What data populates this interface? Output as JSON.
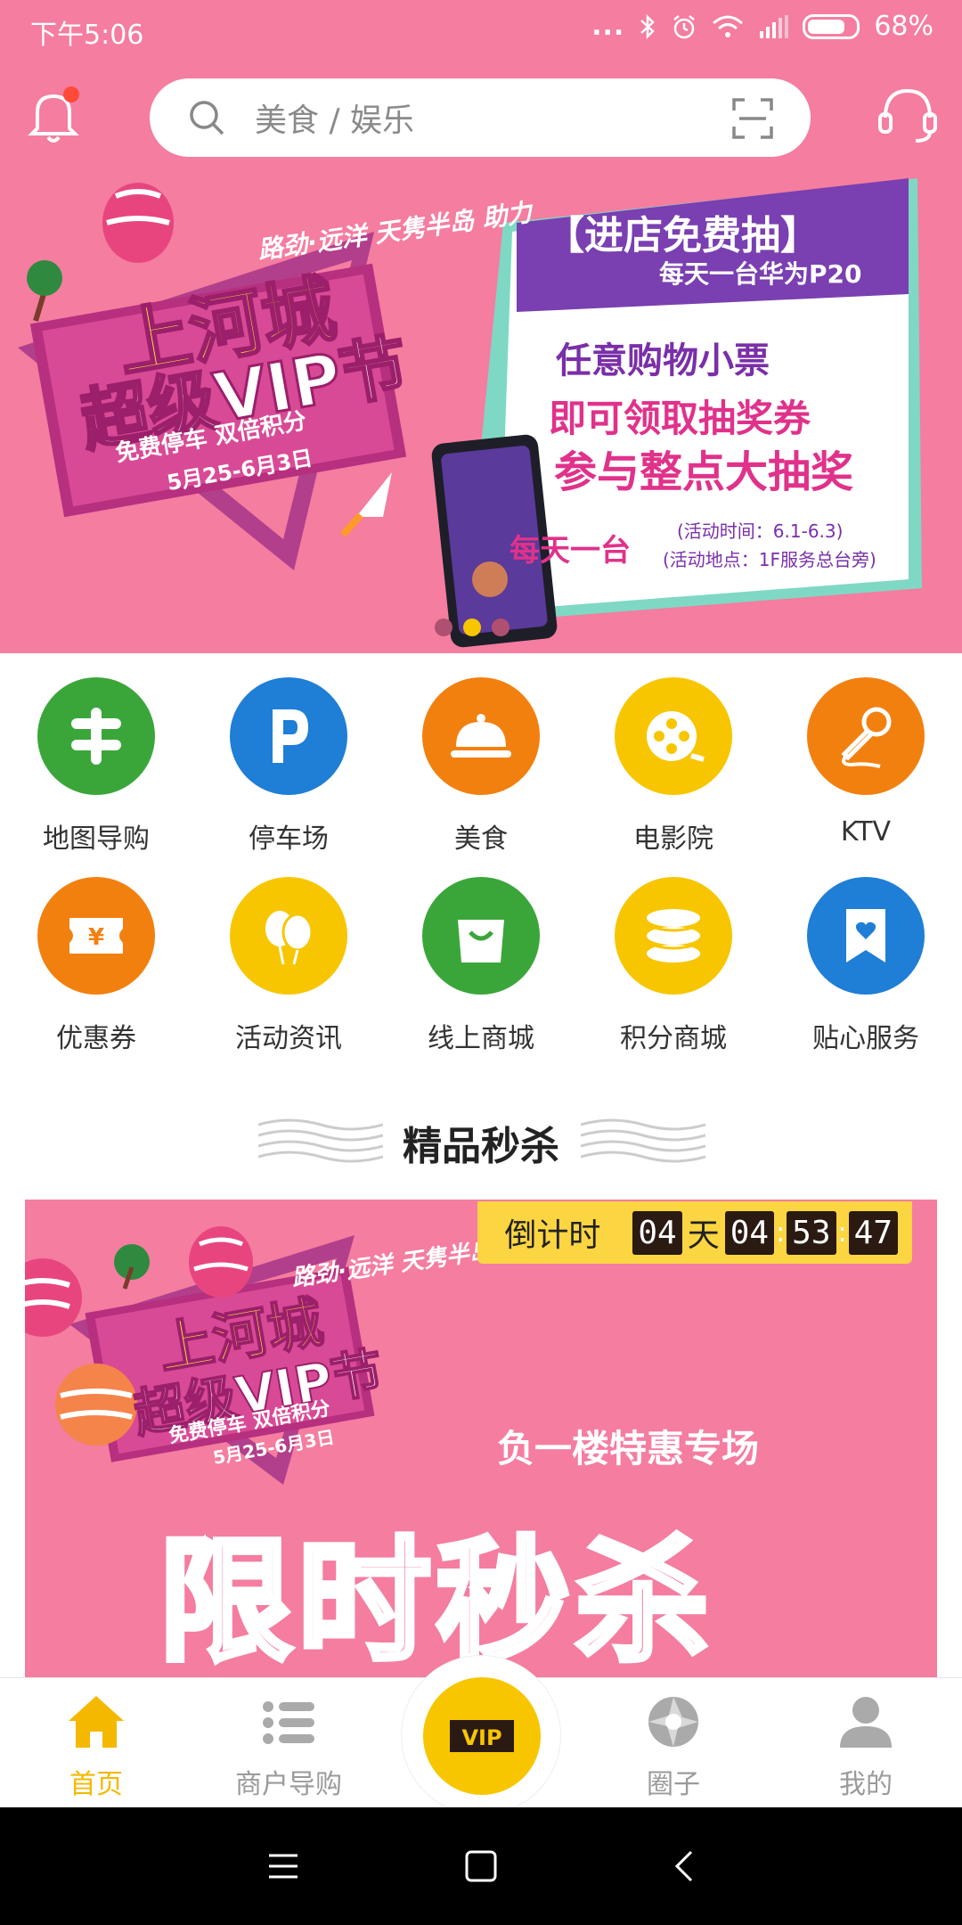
{
  "status": {
    "time": "下午5:06",
    "dots": "...",
    "battery": "68%"
  },
  "search": {
    "placeholder": "美食 / 娱乐"
  },
  "banner": {
    "sponsor": "路劲·远洋 天隽半岛 助力",
    "title_line1": "上河城",
    "title_line2": "超级VIP节",
    "tagline": "免费停车 双倍积分",
    "dates": "5月25-6月3日",
    "card_title": "【进店免费抽】",
    "card_subtitle": "每天一台华为P20",
    "line1": "任意购物小票",
    "line2": "即可领取抽奖券",
    "line3": "参与整点大抽奖",
    "daily": "每天一台",
    "activity_time": "(活动时间：6.1-6.3)",
    "activity_place": "(活动地点：1F服务总台旁)",
    "slide_count": 3,
    "active_slide": 2
  },
  "grid": {
    "row1": [
      {
        "label": "地图导购",
        "icon": "map-guide-icon",
        "color": "#3aa63a"
      },
      {
        "label": "停车场",
        "icon": "parking-icon",
        "color": "#1f7ed6"
      },
      {
        "label": "美食",
        "icon": "food-cloche-icon",
        "color": "#f2800f"
      },
      {
        "label": "电影院",
        "icon": "film-reel-icon",
        "color": "#f7c600"
      },
      {
        "label": "KTV",
        "icon": "microphone-icon",
        "color": "#f2800f"
      }
    ],
    "row2": [
      {
        "label": "优惠券",
        "icon": "coupon-icon",
        "color": "#f2800f"
      },
      {
        "label": "活动资讯",
        "icon": "balloons-icon",
        "color": "#f7c600"
      },
      {
        "label": "线上商城",
        "icon": "shopping-bag-icon",
        "color": "#3aa63a"
      },
      {
        "label": "积分商城",
        "icon": "coins-stack-icon",
        "color": "#f7c600"
      },
      {
        "label": "贴心服务",
        "icon": "heart-bookmark-icon",
        "color": "#1f7ed6"
      }
    ]
  },
  "section": {
    "title": "精品秒杀"
  },
  "flash": {
    "countdown_label": "倒计时",
    "days": "04",
    "day_unit": "天",
    "hours": "04",
    "minutes": "53",
    "seconds": "47",
    "promo": "负一楼特惠专场",
    "big": "限时秒杀",
    "sponsor": "路劲·远洋 天隽半岛 助力",
    "title_line1": "上河城",
    "title_line2": "超级VIP节",
    "tagline": "免费停车 双倍积分",
    "dates": "5月25-6月3日"
  },
  "tabs": {
    "home": "首页",
    "shops": "商户导购",
    "vip": "VIP",
    "circle": "圈子",
    "mine": "我的"
  },
  "colors": {
    "pink": "#f47da0",
    "yellow": "#f7c600",
    "active_tab": "#f5b800"
  }
}
